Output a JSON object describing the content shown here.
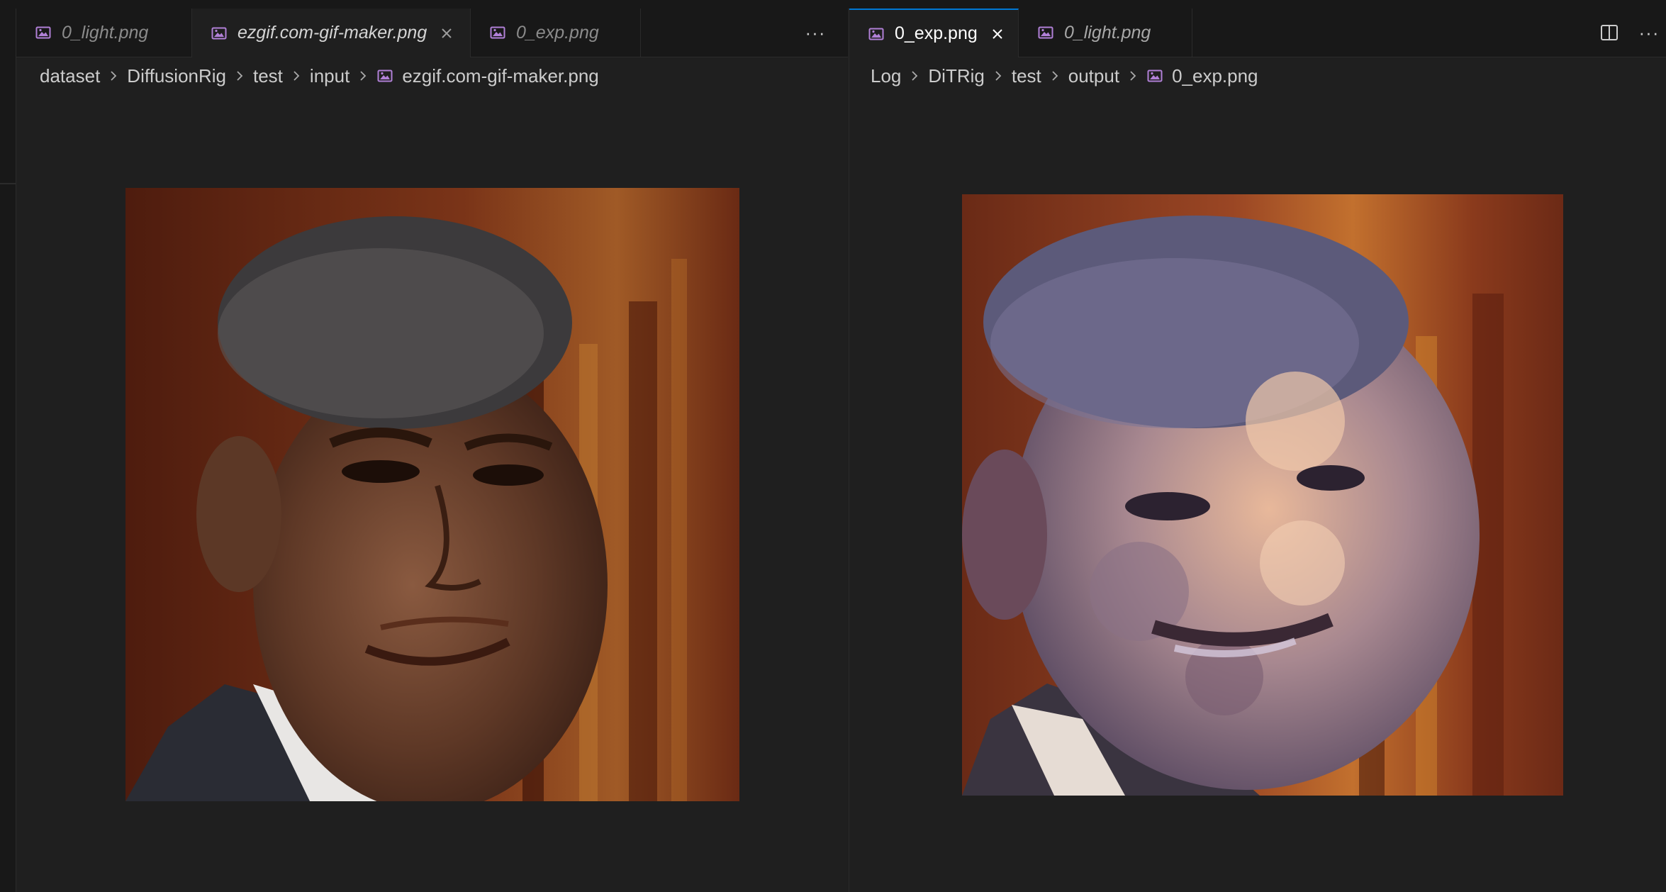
{
  "left_group": {
    "tabs": [
      {
        "label": "0_light.png",
        "active": false,
        "italic": true
      },
      {
        "label": "ezgif.com-gif-maker.png",
        "active": true,
        "italic": true
      },
      {
        "label": "0_exp.png",
        "active": false,
        "italic": true
      }
    ],
    "more_actions_icon": "ellipsis-icon",
    "breadcrumb": [
      "dataset",
      "DiffusionRig",
      "test",
      "input",
      "ezgif.com-gif-maker.png"
    ],
    "image_subject": "portrait photo"
  },
  "right_group": {
    "tabs": [
      {
        "label": "0_exp.png",
        "active": true,
        "italic": false
      },
      {
        "label": "0_light.png",
        "active": false,
        "italic": true
      }
    ],
    "actions": [
      "split-editor-icon",
      "ellipsis-icon"
    ],
    "breadcrumb": [
      "Log",
      "DiTRig",
      "test",
      "output",
      "0_exp.png"
    ],
    "image_subject": "painterly stylized portrait"
  },
  "colors": {
    "accent": "#0078d4",
    "image_icon": "#b180d7",
    "background": "#1f1f1f",
    "tabbar": "#181818"
  }
}
